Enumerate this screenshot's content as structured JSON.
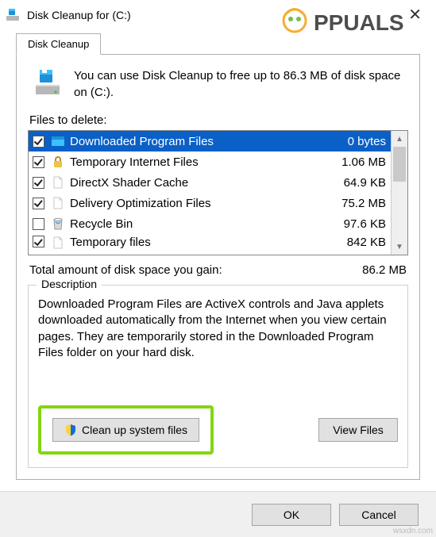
{
  "title": "Disk Cleanup for  (C:)",
  "tab_label": "Disk Cleanup",
  "intro_text": "You can use Disk Cleanup to free up to 86.3 MB of disk space on  (C:).",
  "files_label": "Files to delete:",
  "items": [
    {
      "checked": true,
      "icon": "dpf",
      "name": "Downloaded Program Files",
      "size": "0 bytes",
      "selected": true
    },
    {
      "checked": true,
      "icon": "lock",
      "name": "Temporary Internet Files",
      "size": "1.06 MB",
      "selected": false
    },
    {
      "checked": true,
      "icon": "doc",
      "name": "DirectX Shader Cache",
      "size": "64.9 KB",
      "selected": false
    },
    {
      "checked": true,
      "icon": "doc",
      "name": "Delivery Optimization Files",
      "size": "75.2 MB",
      "selected": false
    },
    {
      "checked": false,
      "icon": "bin",
      "name": "Recycle Bin",
      "size": "97.6 KB",
      "selected": false
    },
    {
      "checked": true,
      "icon": "doc",
      "name": "Temporary files",
      "size": "842 KB",
      "selected": false
    }
  ],
  "total_label": "Total amount of disk space you gain:",
  "total_value": "86.2 MB",
  "description_label": "Description",
  "description_text": "Downloaded Program Files are ActiveX controls and Java applets downloaded automatically from the Internet when you view certain pages. They are temporarily stored in the Downloaded Program Files folder on your hard disk.",
  "buttons": {
    "cleanup_system": "Clean up system files",
    "view_files": "View Files",
    "ok": "OK",
    "cancel": "Cancel"
  },
  "watermark": "Appuals",
  "watermark2": "wsxdn.com"
}
